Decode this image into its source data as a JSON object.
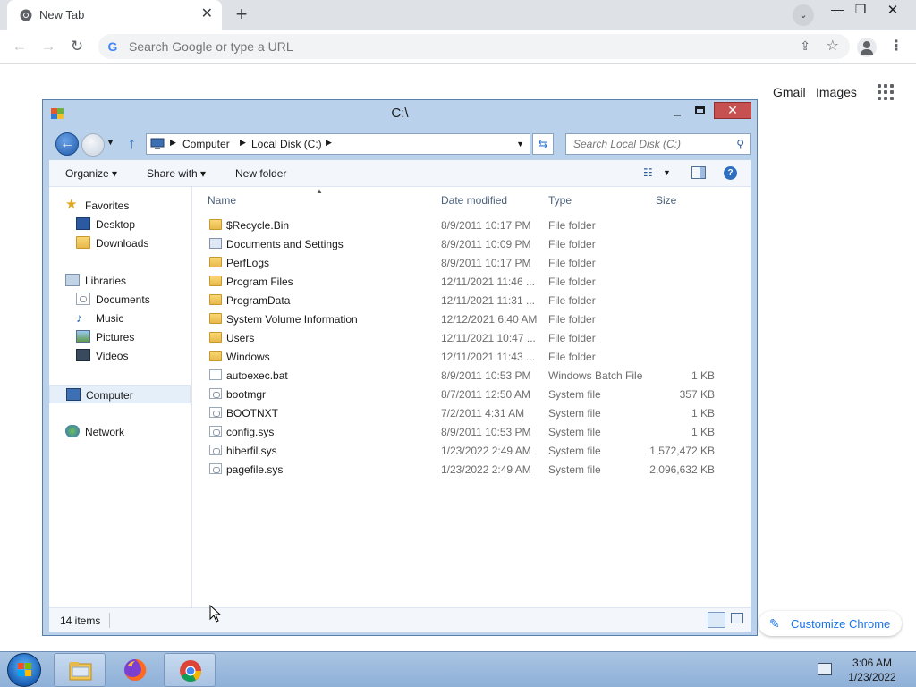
{
  "browser": {
    "tab_title": "New Tab",
    "omnibox_placeholder": "Search Google or type a URL",
    "ntp_links": {
      "gmail": "Gmail",
      "images": "Images"
    },
    "customize_label": "Customize Chrome"
  },
  "explorer": {
    "title": "C:\\",
    "breadcrumb": [
      "Computer",
      "Local Disk (C:)"
    ],
    "search_placeholder": "Search Local Disk (C:)",
    "commands": {
      "organize": "Organize ▾",
      "share_with": "Share with ▾",
      "new_folder": "New folder"
    },
    "nav": [
      {
        "label": "Favorites",
        "icon": "star-icon"
      },
      {
        "label": "Desktop",
        "icon": "desktop-icon"
      },
      {
        "label": "Downloads",
        "icon": "downloads-icon"
      },
      {
        "label": "Libraries",
        "icon": "libraries-icon"
      },
      {
        "label": "Documents",
        "icon": "documents-icon"
      },
      {
        "label": "Music",
        "icon": "music-icon"
      },
      {
        "label": "Pictures",
        "icon": "pictures-icon"
      },
      {
        "label": "Videos",
        "icon": "videos-icon"
      },
      {
        "label": "Computer",
        "icon": "computer-icon",
        "selected": true
      },
      {
        "label": "Network",
        "icon": "network-icon"
      }
    ],
    "columns": {
      "name": "Name",
      "date": "Date modified",
      "type": "Type",
      "size": "Size"
    },
    "files": [
      {
        "name": "$Recycle.Bin",
        "date": "8/9/2011 10:17 PM",
        "type": "File folder",
        "size": "",
        "icon": "folder-icon"
      },
      {
        "name": "Documents and Settings",
        "date": "8/9/2011 10:09 PM",
        "type": "File folder",
        "size": "",
        "icon": "shortcut-folder-icon"
      },
      {
        "name": "PerfLogs",
        "date": "8/9/2011 10:17 PM",
        "type": "File folder",
        "size": "",
        "icon": "folder-icon"
      },
      {
        "name": "Program Files",
        "date": "12/11/2021 11:46 ...",
        "type": "File folder",
        "size": "",
        "icon": "folder-icon"
      },
      {
        "name": "ProgramData",
        "date": "12/11/2021 11:31 ...",
        "type": "File folder",
        "size": "",
        "icon": "folder-icon"
      },
      {
        "name": "System Volume Information",
        "date": "12/12/2021 6:40 AM",
        "type": "File folder",
        "size": "",
        "icon": "folder-icon"
      },
      {
        "name": "Users",
        "date": "12/11/2021 10:47 ...",
        "type": "File folder",
        "size": "",
        "icon": "folder-icon"
      },
      {
        "name": "Windows",
        "date": "12/11/2021 11:43 ...",
        "type": "File folder",
        "size": "",
        "icon": "folder-icon"
      },
      {
        "name": "autoexec.bat",
        "date": "8/9/2011 10:53 PM",
        "type": "Windows Batch File",
        "size": "1 KB",
        "icon": "batch-file-icon"
      },
      {
        "name": "bootmgr",
        "date": "8/7/2011 12:50 AM",
        "type": "System file",
        "size": "357 KB",
        "icon": "system-file-icon"
      },
      {
        "name": "BOOTNXT",
        "date": "7/2/2011 4:31 AM",
        "type": "System file",
        "size": "1 KB",
        "icon": "system-file-icon"
      },
      {
        "name": "config.sys",
        "date": "8/9/2011 10:53 PM",
        "type": "System file",
        "size": "1 KB",
        "icon": "system-file-icon"
      },
      {
        "name": "hiberfil.sys",
        "date": "1/23/2022 2:49 AM",
        "type": "System file",
        "size": "1,572,472 KB",
        "icon": "system-file-icon"
      },
      {
        "name": "pagefile.sys",
        "date": "1/23/2022 2:49 AM",
        "type": "System file",
        "size": "2,096,632 KB",
        "icon": "system-file-icon"
      }
    ],
    "status_count": "14 items"
  },
  "taskbar": {
    "time": "3:06 AM",
    "date": "1/23/2022"
  },
  "colors": {
    "window_frame": "#b9d1ea",
    "close_button": "#c75050",
    "accent_blue": "#1a73e8"
  }
}
